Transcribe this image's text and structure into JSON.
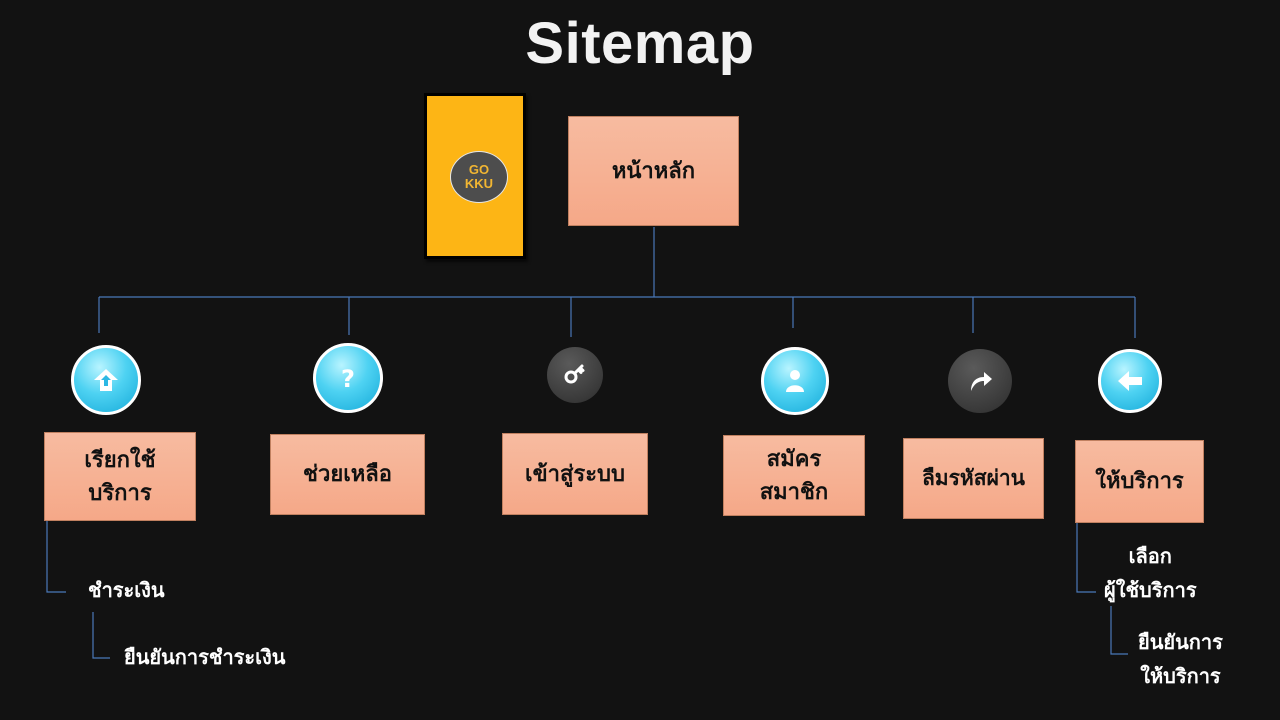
{
  "title": "Sitemap",
  "logo": {
    "text_line1": "GO",
    "text_line2": "KKU",
    "card_color": "#fdb515"
  },
  "root": {
    "label": "หน้าหลัก"
  },
  "nodes": [
    {
      "label_line1": "เรียกใช้",
      "label_line2": "บริการ",
      "icon": "upload-home-icon"
    },
    {
      "label_line1": "ช่วยเหลือ",
      "label_line2": "",
      "icon": "help-question-icon"
    },
    {
      "label_line1": "เข้าสู่ระบบ",
      "label_line2": "",
      "icon": "key-icon"
    },
    {
      "label_line1": "สมัคร",
      "label_line2": "สมาชิก",
      "icon": "user-icon"
    },
    {
      "label_line1": "ลืมรหัสผ่าน",
      "label_line2": "",
      "icon": "redo-arrow-icon"
    },
    {
      "label_line1": "ให้บริการ",
      "label_line2": "",
      "icon": "back-arrow-icon"
    }
  ],
  "subnodes": {
    "payment": "ชำระเงิน",
    "confirm_payment": "ยืนยันการชำระเงิน",
    "choose_user_line1": "เลือก",
    "choose_user_line2": "ผู้ใช้บริการ",
    "confirm_service_line1": "ยืนยันการ",
    "confirm_service_line2": "ให้บริการ"
  },
  "colors": {
    "background": "#121212",
    "box_fill": "#f6b094",
    "connector": "#4a78b8",
    "icon_aqua": "#3cc6ee",
    "icon_dark": "#3a3a3a"
  }
}
